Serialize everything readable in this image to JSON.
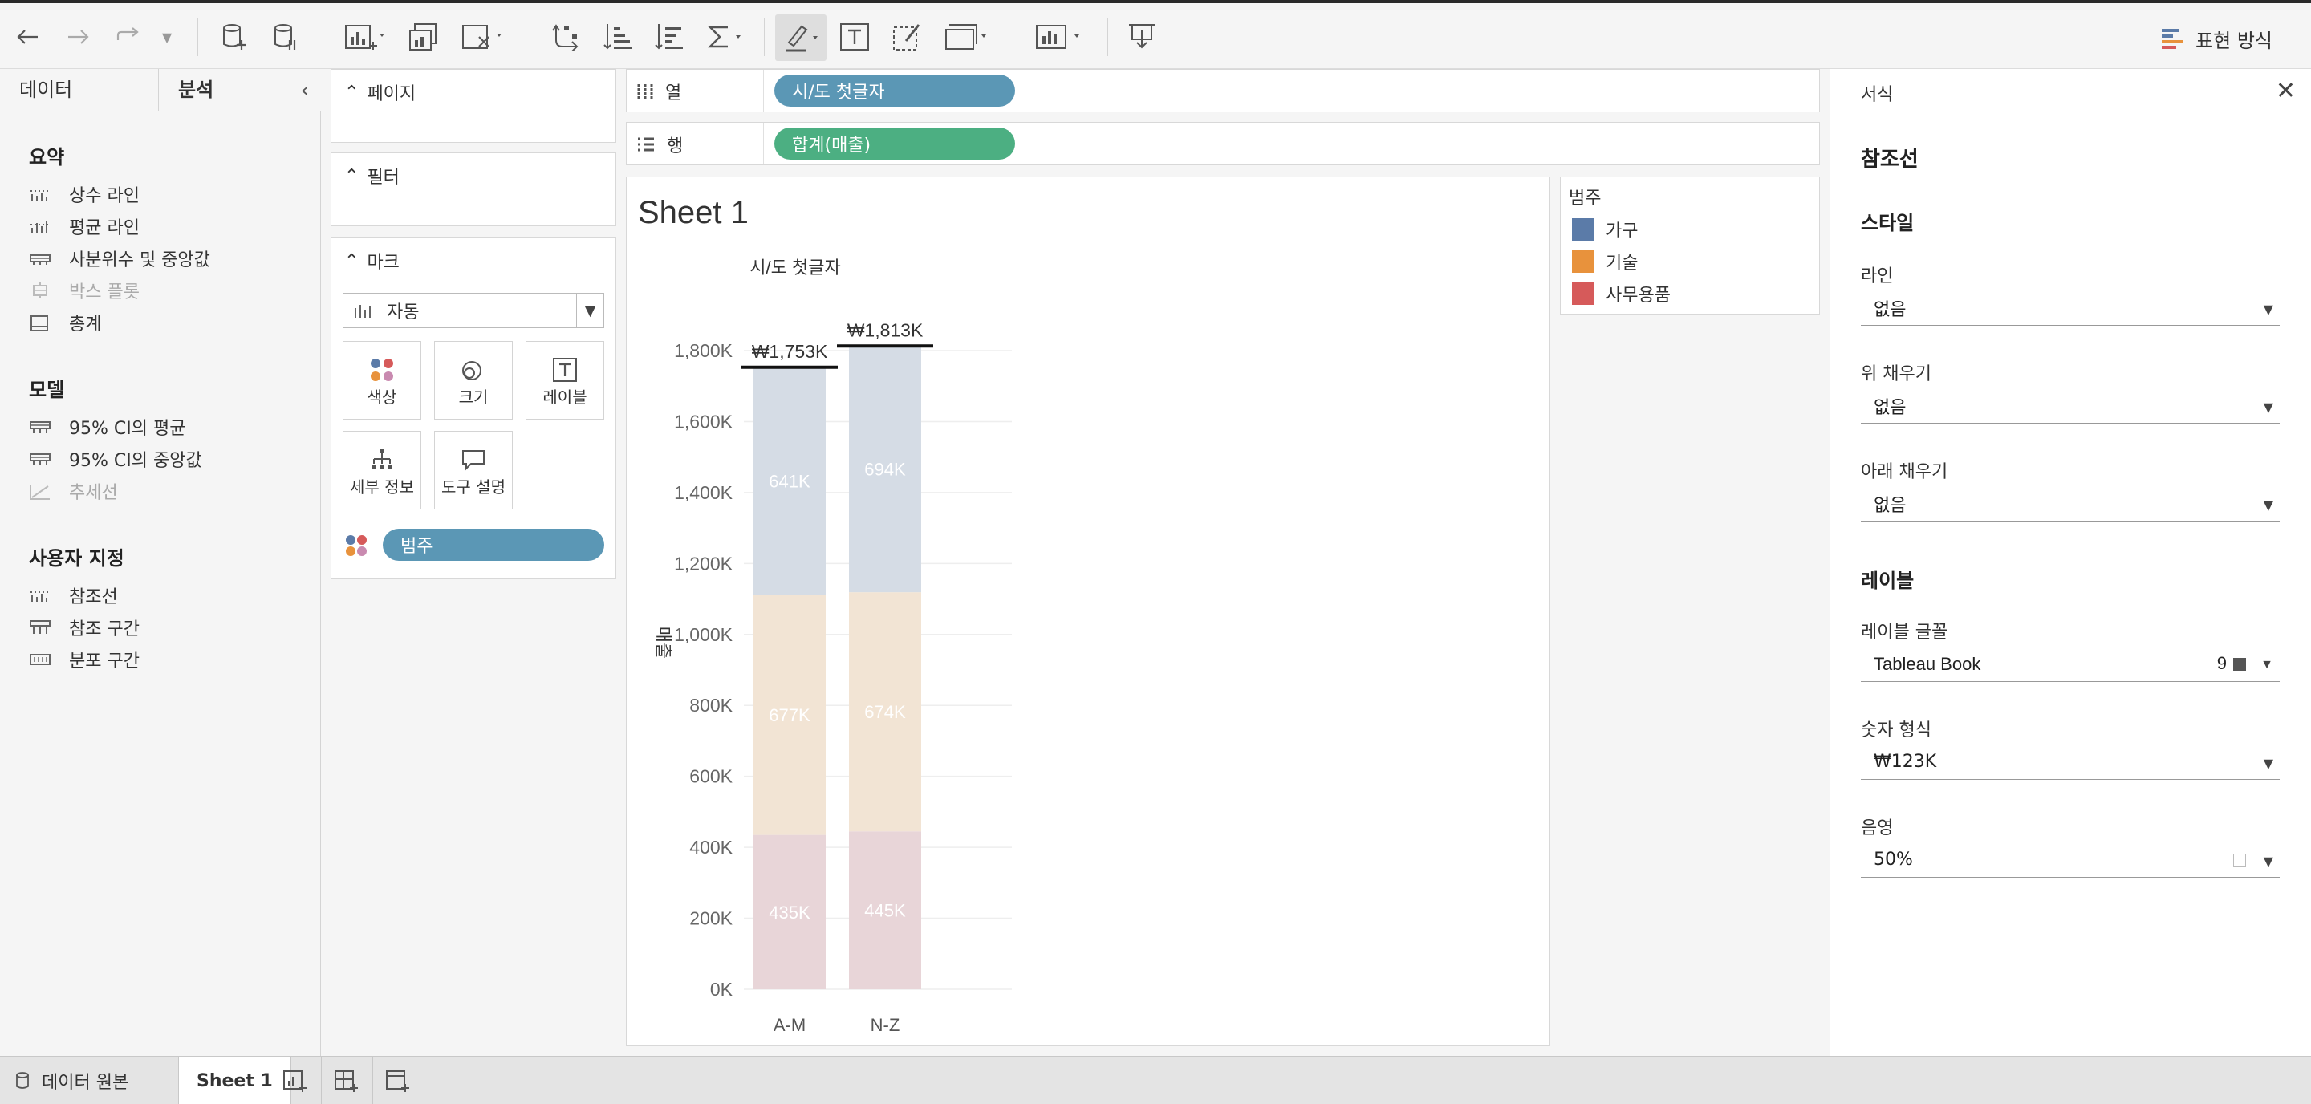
{
  "toolbar": {
    "show_me_label": "표현 방식"
  },
  "left_pane": {
    "tabs": [
      {
        "label": "데이터"
      },
      {
        "label": "분석"
      }
    ],
    "sections": [
      {
        "title": "요약",
        "items": [
          {
            "label": "상수 라인",
            "enabled": true
          },
          {
            "label": "평균 라인",
            "enabled": true
          },
          {
            "label": "사분위수 및 중앙값",
            "enabled": true
          },
          {
            "label": "박스 플롯",
            "enabled": false
          },
          {
            "label": "총계",
            "enabled": true
          }
        ]
      },
      {
        "title": "모델",
        "items": [
          {
            "label": "95% CI의 평균",
            "enabled": true
          },
          {
            "label": "95% CI의 중앙값",
            "enabled": true
          },
          {
            "label": "추세선",
            "enabled": false
          }
        ]
      },
      {
        "title": "사용자 지정",
        "items": [
          {
            "label": "참조선",
            "enabled": true
          },
          {
            "label": "참조 구간",
            "enabled": true
          },
          {
            "label": "분포 구간",
            "enabled": true
          }
        ]
      }
    ]
  },
  "cards": {
    "pages": "페이지",
    "filters": "필터",
    "marks": "마크",
    "mark_type": "자동",
    "mark_buttons": [
      {
        "label": "색상",
        "icon": "color-icon"
      },
      {
        "label": "크기",
        "icon": "size-icon"
      },
      {
        "label": "레이블",
        "icon": "label-icon"
      },
      {
        "label": "세부 정보",
        "icon": "detail-icon"
      },
      {
        "label": "도구 설명",
        "icon": "tooltip-icon"
      }
    ],
    "color_pill": "범주"
  },
  "shelves": {
    "columns_label": "열",
    "columns_pill": "시/도 첫글자",
    "rows_label": "행",
    "rows_pill": "합계(매출)"
  },
  "sheet": {
    "title": "Sheet 1",
    "header": "시/도 첫글자",
    "y_axis_label": "매출"
  },
  "legend": {
    "title": "범주",
    "items": [
      {
        "label": "가구",
        "color": "#5b7ba8"
      },
      {
        "label": "기술",
        "color": "#e8923c"
      },
      {
        "label": "사무용품",
        "color": "#d65a5a"
      }
    ]
  },
  "chart_data": {
    "type": "bar",
    "stacked": true,
    "categories": [
      "A-M",
      "N-Z"
    ],
    "series": [
      {
        "name": "사무용품",
        "values": [
          435,
          445
        ],
        "labels": [
          "435K",
          "445K"
        ],
        "color": "#e8d5d8"
      },
      {
        "name": "기술",
        "values": [
          677,
          674
        ],
        "labels": [
          "677K",
          "674K"
        ],
        "color": "#f2e4d4"
      },
      {
        "name": "가구",
        "values": [
          641,
          694
        ],
        "labels": [
          "641K",
          "694K"
        ],
        "color": "#d5dce5"
      }
    ],
    "reference_labels": [
      "₩1,753K",
      "₩1,813K"
    ],
    "reference_values": [
      1753,
      1813
    ],
    "y_ticks": [
      "0K",
      "200K",
      "400K",
      "600K",
      "800K",
      "1,000K",
      "1,200K",
      "1,400K",
      "1,600K",
      "1,800K"
    ],
    "ylim": [
      0,
      1800
    ],
    "ylabel": "매출",
    "grid": true
  },
  "format_pane": {
    "title": "서식",
    "heading": "참조선",
    "style_heading": "스타일",
    "line_label": "라인",
    "line_value": "없음",
    "fill_above_label": "위 채우기",
    "fill_above_value": "없음",
    "fill_below_label": "아래 채우기",
    "fill_below_value": "없음",
    "label_heading": "레이블",
    "label_font_label": "레이블 글꼴",
    "label_font_value": "Tableau Book",
    "label_font_size": "9",
    "number_format_label": "숫자 형식",
    "number_format_value": "₩123K",
    "shading_label": "음영",
    "shading_value": "50%"
  },
  "statusbar": {
    "data_source": "데이터 원본",
    "sheet_tab": "Sheet 1"
  }
}
